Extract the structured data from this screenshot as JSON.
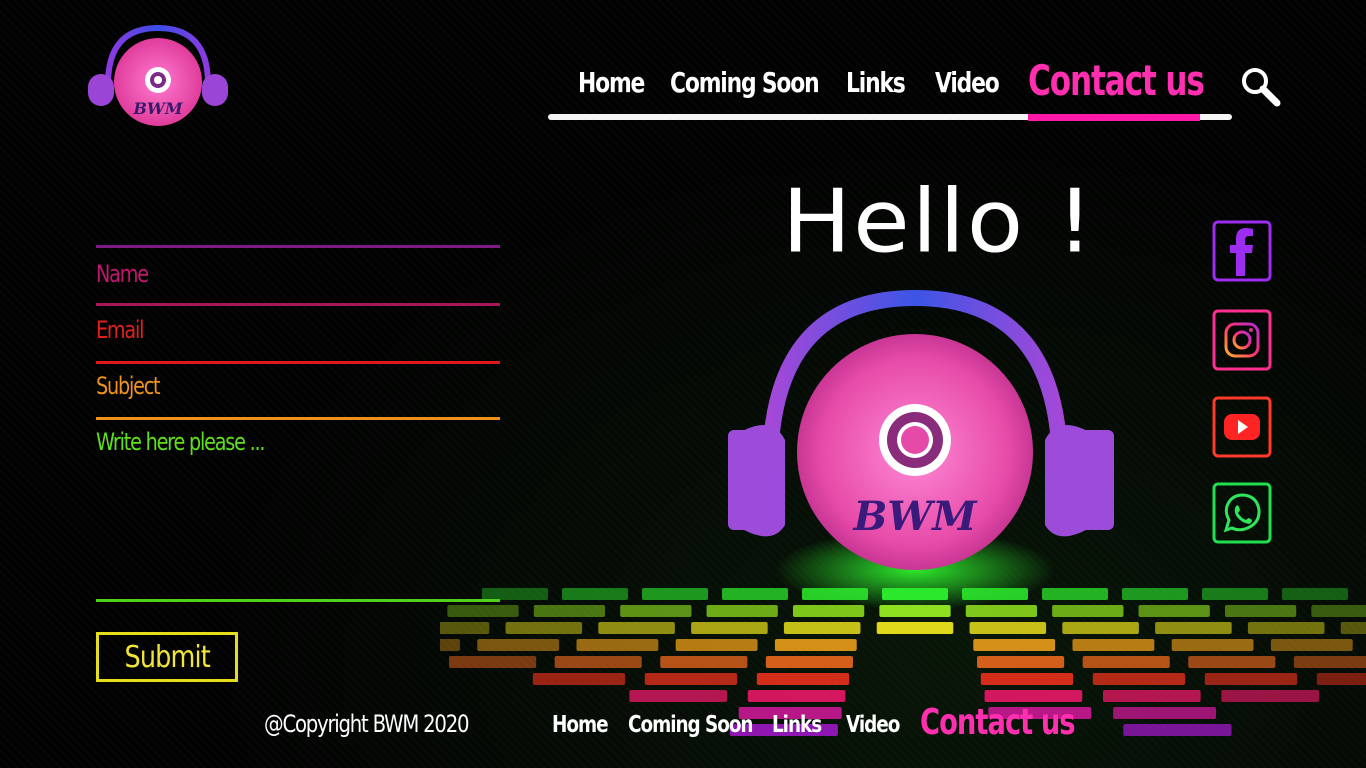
{
  "logo": {
    "text": "BWM"
  },
  "nav": {
    "items": [
      {
        "label": "Home"
      },
      {
        "label": "Coming Soon"
      },
      {
        "label": "Links"
      },
      {
        "label": "Video"
      },
      {
        "label": "Contact us",
        "active": true
      }
    ],
    "search_icon": "search-icon"
  },
  "hero": {
    "greeting": "Hello !",
    "logo_text": "BWM"
  },
  "form": {
    "fields": [
      {
        "label": "Name",
        "color": "#c0186e",
        "rule_color": "#7d1a86"
      },
      {
        "label": "Email",
        "color": "#e0201e",
        "rule_color": "#a5185a"
      },
      {
        "label": "Subject",
        "color": "#f0921c",
        "rule_color": "#e0181e"
      },
      {
        "label": "Write here please ...",
        "color": "#5fe01c",
        "rule_color": "#f09018"
      }
    ],
    "bottom_rule_color": "#4fd11c",
    "submit_label": "Submit"
  },
  "social": [
    {
      "icon": "facebook-icon",
      "color": "#9b2cf0"
    },
    {
      "icon": "instagram-icon",
      "color": "#ff2f8f"
    },
    {
      "icon": "youtube-icon",
      "color": "#ff3a2a"
    },
    {
      "icon": "whatsapp-icon",
      "color": "#21e050"
    }
  ],
  "footer": {
    "copyright": "@Copyright BWM 2020",
    "items": [
      {
        "label": "Home"
      },
      {
        "label": "Coming Soon"
      },
      {
        "label": "Links"
      },
      {
        "label": "Video"
      },
      {
        "label": "Contact us",
        "active": true
      }
    ]
  }
}
